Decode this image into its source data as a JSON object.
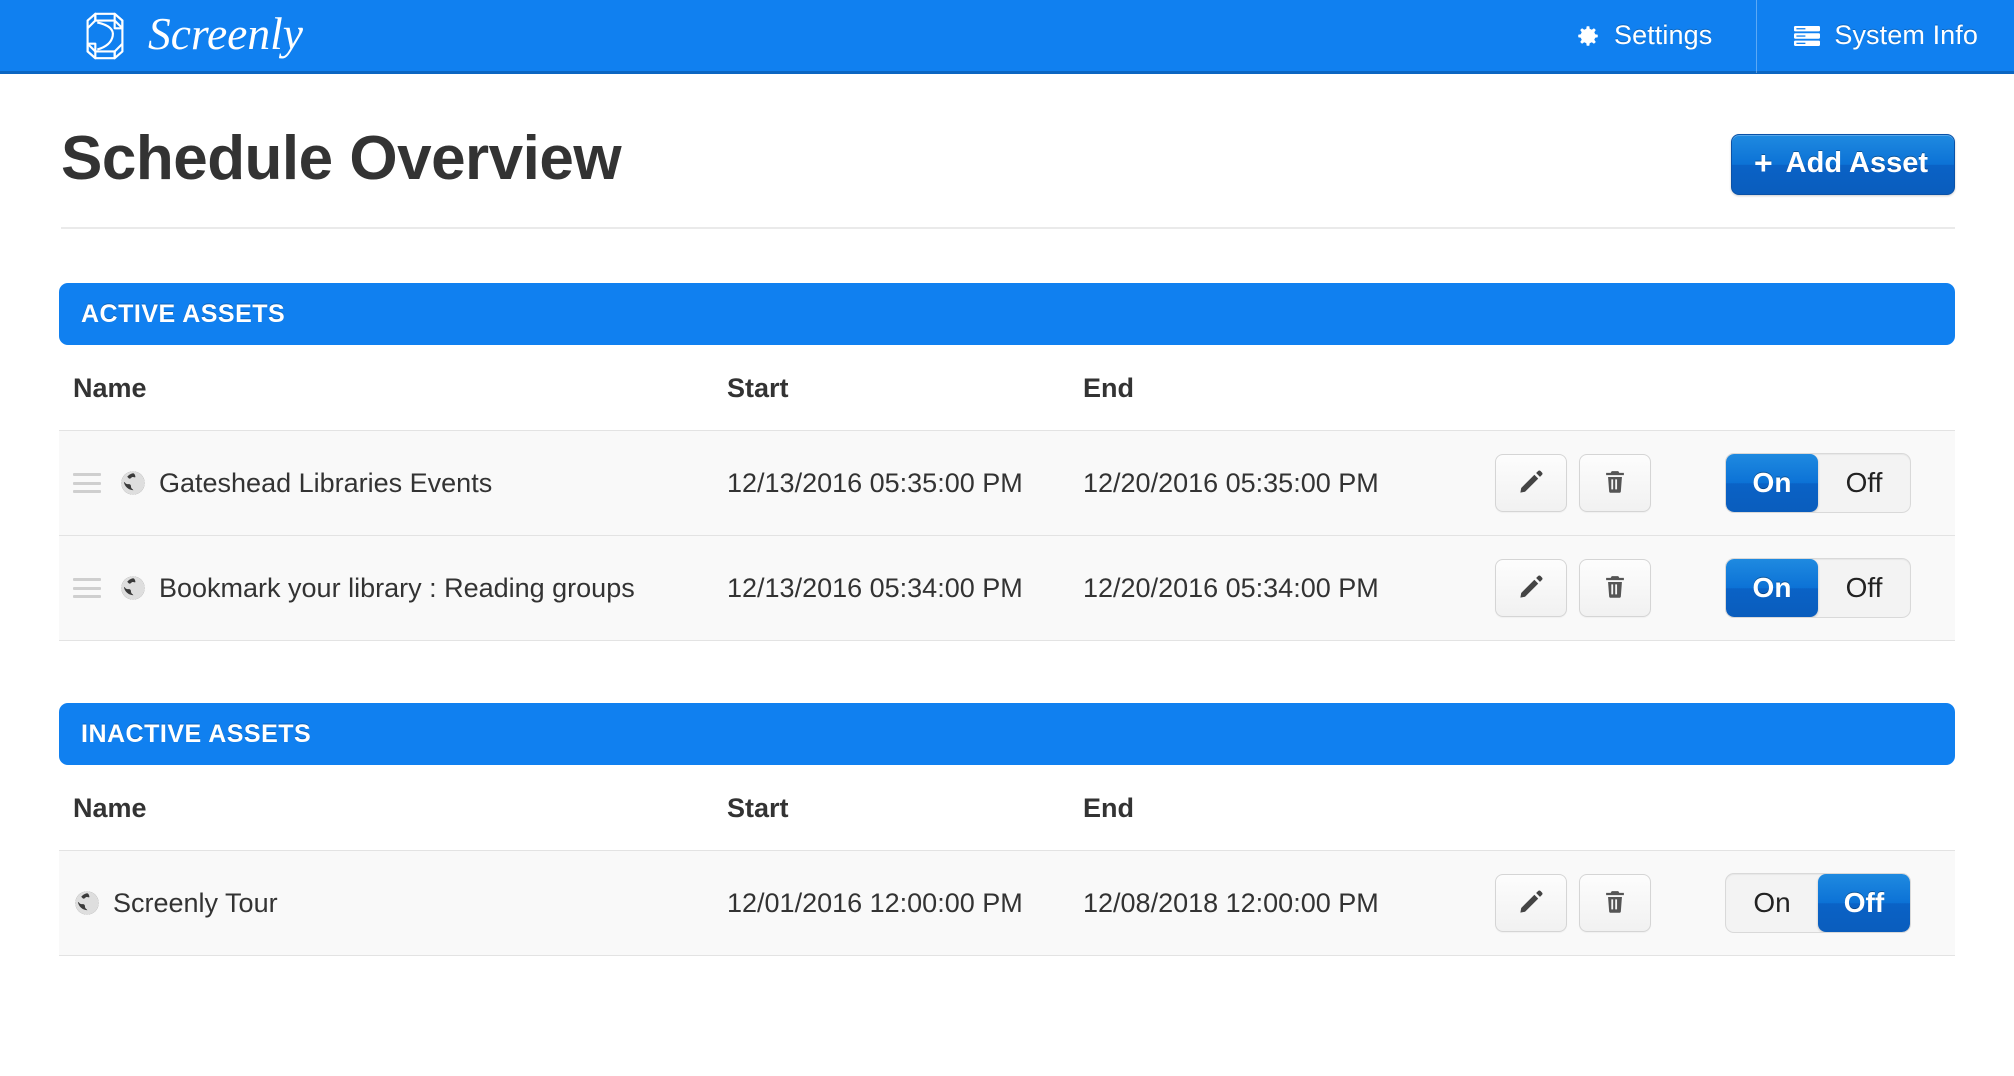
{
  "navbar": {
    "brand_name": "Screenly",
    "logo_icon": "screenly-hex-s-icon",
    "items": [
      {
        "label": "Settings",
        "icon": "gear-icon"
      },
      {
        "label": "System Info",
        "icon": "server-stack-icon"
      }
    ]
  },
  "page": {
    "title": "Schedule Overview",
    "add_button_label": "Add Asset",
    "add_button_icon": "plus-icon"
  },
  "colors": {
    "brand_blue": "#1080f0",
    "navbar_border": "#0b66c2",
    "button_blue_top": "#1f8ae0",
    "button_blue_bottom": "#0a5dbd",
    "row_bg": "#f9f9f9",
    "row_border": "#e3e3e3",
    "text_dark": "#333333"
  },
  "columns": {
    "name": "Name",
    "start": "Start",
    "end": "End"
  },
  "row_icons": {
    "drag": "drag-handle-icon",
    "globe": "globe-icon",
    "edit": "pencil-icon",
    "delete": "trash-icon"
  },
  "toggle": {
    "on_label": "On",
    "off_label": "Off"
  },
  "sections": [
    {
      "id": "active",
      "title": "ACTIVE ASSETS",
      "has_drag_handles": true,
      "rows": [
        {
          "name": "Gateshead Libraries Events",
          "start": "12/13/2016 05:35:00 PM",
          "end": "12/20/2016 05:35:00 PM",
          "state": "On"
        },
        {
          "name": "Bookmark your library : Reading groups",
          "start": "12/13/2016 05:34:00 PM",
          "end": "12/20/2016 05:34:00 PM",
          "state": "On"
        }
      ]
    },
    {
      "id": "inactive",
      "title": "INACTIVE ASSETS",
      "has_drag_handles": false,
      "rows": [
        {
          "name": "Screenly Tour",
          "start": "12/01/2016 12:00:00 PM",
          "end": "12/08/2018 12:00:00 PM",
          "state": "Off"
        }
      ]
    }
  ]
}
